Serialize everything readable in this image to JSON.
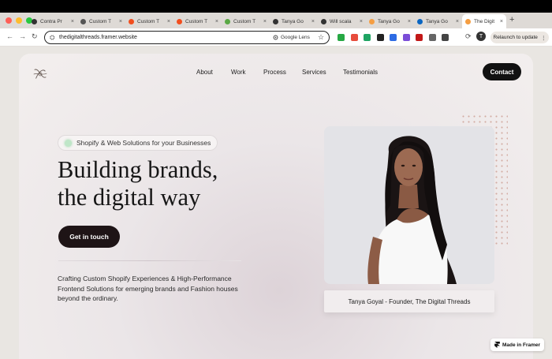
{
  "browser": {
    "tabs": [
      {
        "label": "Contra Pr",
        "color": "#333333"
      },
      {
        "label": "Custom T",
        "color": "#555555"
      },
      {
        "label": "Custom T",
        "color": "#f24e1e"
      },
      {
        "label": "Custom T",
        "color": "#f24e1e"
      },
      {
        "label": "Custom T",
        "color": "#5aa845"
      },
      {
        "label": "Tanya Go",
        "color": "#333333"
      },
      {
        "label": "Will scala",
        "color": "#333333"
      },
      {
        "label": "Tanya Go",
        "color": "#f59e42"
      },
      {
        "label": "Tanya Go",
        "color": "#0a66c2"
      },
      {
        "label": "The Digit",
        "color": "#f59e42"
      }
    ],
    "new_tab": "+",
    "url": "thedigitalthreads.framer.website",
    "lens_label": "Google Lens",
    "relaunch_label": "Relaunch to update",
    "profile_initial": "T",
    "icons": {
      "back": "←",
      "forward": "→",
      "reload": "↻",
      "lock": "⛭",
      "star": "☆",
      "close": "×",
      "more": "⋮"
    },
    "extension_colors": [
      "#27a844",
      "#e74c3c",
      "#1fa463",
      "#222222",
      "#2d6be4",
      "#7b4dd8",
      "#c21818",
      "#666666",
      "#444444"
    ]
  },
  "site": {
    "nav": [
      "About",
      "Work",
      "Process",
      "Services",
      "Testimonials"
    ],
    "contact_label": "Contact",
    "badge": "Shopify & Web Solutions for your Businesses",
    "headline_line1": "Building brands,",
    "headline_line2": "the digital way",
    "cta_label": "Get in touch",
    "description": "Crafting Custom Shopify Experiences & High-Performance Frontend Solutions for emerging brands and Fashion houses beyond the ordinary.",
    "caption": "Tanya Goyal - Founder, The Digital Threads",
    "framer_badge": "Made in Framer"
  }
}
